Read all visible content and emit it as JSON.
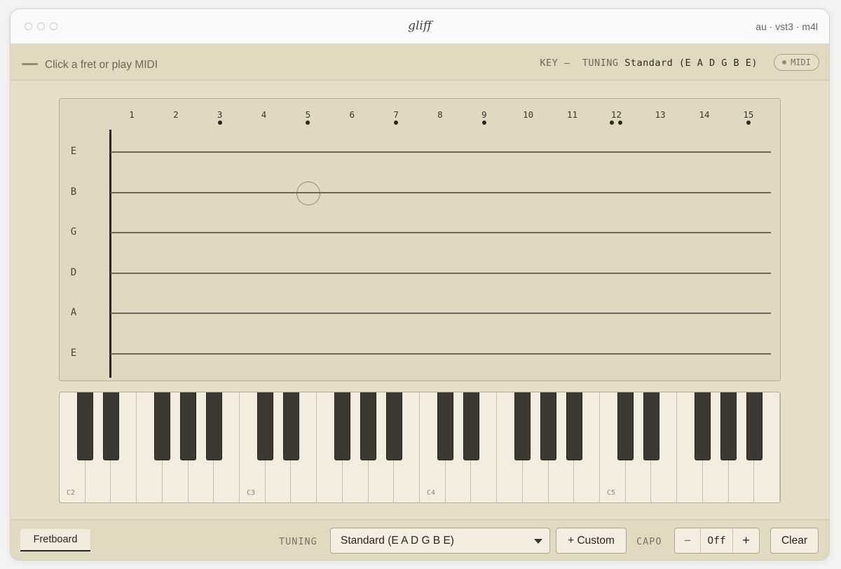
{
  "window": {
    "title": "gliff",
    "formats": "au · vst3 · m4l"
  },
  "status": {
    "message": "Click a fret or play MIDI",
    "key_label": "KEY",
    "key_value": "—",
    "tuning_label": "TUNING",
    "tuning_value": "Standard (E A D G B E)",
    "midi_label": "MIDI"
  },
  "fretboard": {
    "frets": [
      "1",
      "2",
      "3",
      "4",
      "5",
      "6",
      "7",
      "8",
      "9",
      "10",
      "11",
      "12",
      "13",
      "14",
      "15"
    ],
    "inlays": [
      3,
      5,
      7,
      9,
      15
    ],
    "double_inlay": 12,
    "strings": [
      "E",
      "B",
      "G",
      "D",
      "A",
      "E"
    ]
  },
  "keyboard": {
    "octave_labels": [
      "C2",
      "C3",
      "C4",
      "C5"
    ]
  },
  "bottom": {
    "tab_label": "Fretboard",
    "tuning_label": "TUNING",
    "tuning_selected": "Standard (E A D G B E)",
    "custom_label": "+ Custom",
    "capo_label": "CAPO",
    "capo_minus": "−",
    "capo_value": "Off",
    "capo_plus": "+",
    "clear_label": "Clear"
  },
  "colors": {
    "background": "#e6dec9",
    "panel": "#e1d8c1",
    "string": "#6e6658",
    "black_key": "#3c3932",
    "white_key": "#f3eddf"
  }
}
